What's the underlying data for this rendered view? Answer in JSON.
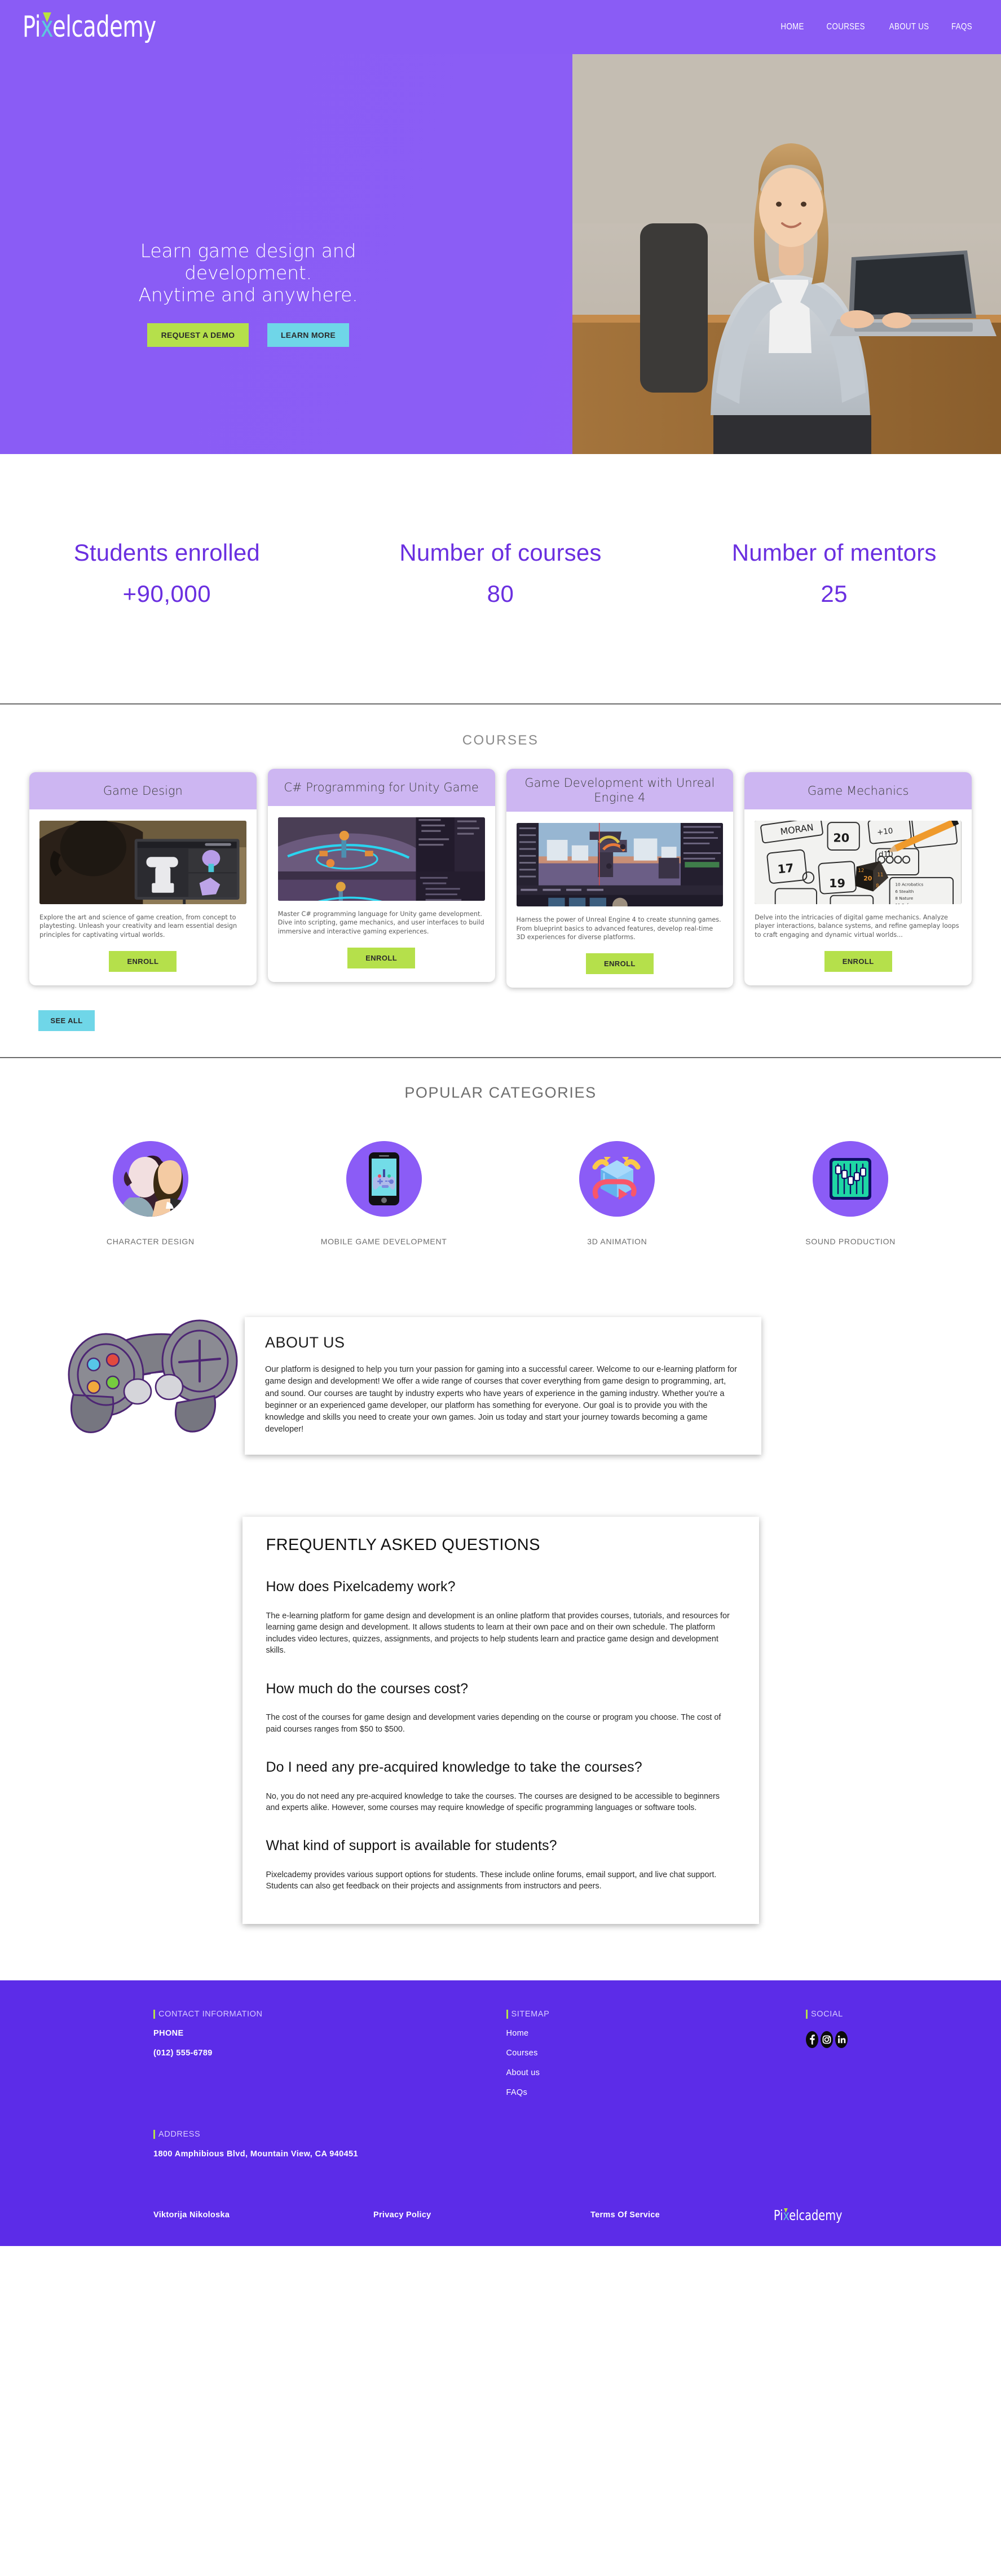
{
  "brand": {
    "name_pre": "P",
    "name_i": "i",
    "name_x": "x",
    "name_post": "elcademy",
    "full": "Pixelcademy"
  },
  "nav": {
    "items": [
      {
        "label": "HOME"
      },
      {
        "label": "COURSES"
      },
      {
        "label": "ABOUT US"
      },
      {
        "label": "FAQS"
      }
    ]
  },
  "hero": {
    "line1": "Learn game design and development.",
    "line2": "Anytime and anywhere.",
    "primary_button": "REQUEST A DEMO",
    "secondary_button": "LEARN MORE",
    "primary_color": "#b5e04b",
    "secondary_color": "#6fd6e8",
    "background_color": "#8a5cf5"
  },
  "stats": {
    "accent_color": "#6a2fe0",
    "items": [
      {
        "label": "Students enrolled",
        "value": "+90,000"
      },
      {
        "label": "Number of courses",
        "value": "80"
      },
      {
        "label": "Number of mentors",
        "value": "25"
      }
    ]
  },
  "courses": {
    "heading": "COURSES",
    "see_all_label": "SEE ALL",
    "enroll_label": "ENROLL",
    "items": [
      {
        "title": "Game Design",
        "description": "Explore the art and science of game creation, from concept to playtesting. Unleash your creativity and learn essential design principles for captivating virtual worlds.",
        "image_alt": "student-at-3d-modeling-workstation"
      },
      {
        "title": "C# Programming for Unity Game",
        "description": "Master C# programming language for Unity game development. Dive into scripting, game mechanics, and user interfaces to build immersive and interactive gaming experiences.",
        "image_alt": "unity-editor-scene-view"
      },
      {
        "title": "Game Development with Unreal Engine 4",
        "description": "Harness the power of Unreal Engine 4 to create stunning games. From blueprint basics to advanced features, develop real-time 3D experiences for diverse platforms.",
        "image_alt": "unreal-engine-editor-city-scene"
      },
      {
        "title": "Game Mechanics",
        "description": "Delve into the intricacies of digital game mechanics. Analyze player interactions, balance systems, and refine gameplay loops to craft engaging and dynamic virtual worlds...",
        "image_alt": "tabletop-character-sheet-with-d20-dice"
      }
    ]
  },
  "categories": {
    "heading": "POPULAR CATEGORIES",
    "items": [
      {
        "label": "CHARACTER DESIGN",
        "icon": "two-people-icon"
      },
      {
        "label": "MOBILE GAME DEVELOPMENT",
        "icon": "smartphone-gamepad-icon"
      },
      {
        "label": "3D ANIMATION",
        "icon": "rotating-cube-icon"
      },
      {
        "label": "SOUND PRODUCTION",
        "icon": "equalizer-sliders-icon"
      }
    ]
  },
  "about": {
    "title": "ABOUT US",
    "body": "Our platform is designed to help you turn your passion for gaming into a successful career. Welcome to our e-learning platform for game design and development! We offer a wide range of courses that cover everything from game design to programming, art, and sound. Our courses are taught by industry experts who have years of experience in the gaming industry. Whether you're a beginner or an experienced game developer, our platform has something for everyone. Our goal is to provide you with the knowledge and skills you need to create your own games. Join us today and start your journey towards becoming a game developer!",
    "illustration": "game-controller-illustration"
  },
  "faq": {
    "title": "FREQUENTLY ASKED QUESTIONS",
    "items": [
      {
        "question": "How does Pixelcademy work?",
        "answer": "The e-learning platform for game design and development is an online platform that provides courses, tutorials, and resources for learning game design and development. It allows students to learn at their own pace and on their own schedule. The platform includes video lectures, quizzes, assignments, and projects to help students learn and practice game design and development skills."
      },
      {
        "question": "How much do the courses cost?",
        "answer": "The cost of the courses for game design and development varies depending on the course or program you choose. The cost of paid courses ranges from $50 to $500."
      },
      {
        "question": "Do I need any pre-acquired knowledge to take the courses?",
        "answer": "No, you do not need any pre-acquired knowledge to take the courses. The courses are designed to be accessible to beginners and experts alike. However, some courses may require knowledge of specific programming languages or software tools."
      },
      {
        "question": "What kind of support is available for students?",
        "answer": "Pixelcademy provides various support options for students. These include online forums, email support, and live chat support. Students can also get feedback on their projects and assignments from instructors and peers."
      }
    ]
  },
  "footer": {
    "background_color": "#5c2ce8",
    "accent_color": "#b5e04b",
    "contact_heading": "CONTACT INFORMATION",
    "phone_label": "PHONE",
    "phone_value": "(012) 555-6789",
    "address_heading": "ADDRESS",
    "address_value": "1800 Amphibious Blvd, Mountain View, CA 940451",
    "sitemap_heading": "SITEMAP",
    "sitemap_links": [
      {
        "label": "Home"
      },
      {
        "label": "Courses"
      },
      {
        "label": "About us"
      },
      {
        "label": "FAQs"
      }
    ],
    "social_heading": "SOCIAL",
    "social_icons": [
      {
        "name": "facebook-icon"
      },
      {
        "name": "instagram-icon"
      },
      {
        "name": "linkedin-icon"
      }
    ],
    "bottom": {
      "author": "Viktorija Nikoloska",
      "privacy": "Privacy Policy",
      "terms": "Terms Of Service"
    }
  }
}
